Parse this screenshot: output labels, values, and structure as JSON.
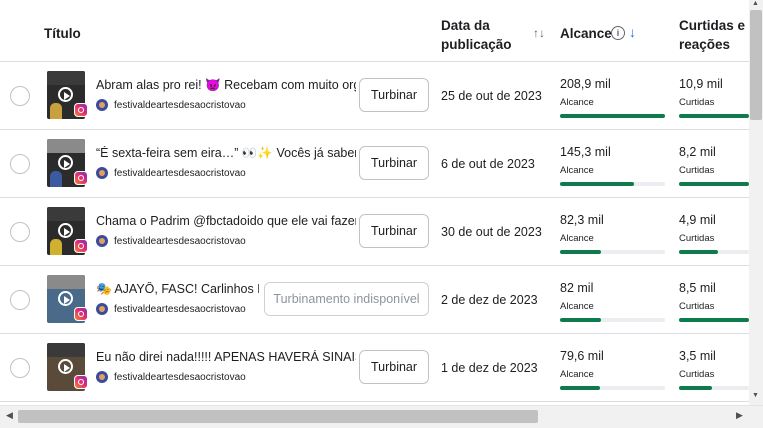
{
  "header": {
    "title": "Título",
    "date": "Data da publicação",
    "sort_icon": "↑↓",
    "reach": "Alcance",
    "info_icon": "i",
    "sort_desc_icon": "↓",
    "likes": "Curtidas e reações"
  },
  "rows": [
    {
      "caption": "Abram alas pro rei! 👿 Recebam com muito orgulho…",
      "account": "festivaldeartesdesaocristovao",
      "boost": "Turbinar",
      "date": "25 de out de 2023",
      "reach": "208,9 mil",
      "reach_label": "Alcance",
      "reach_fraction": 1.0,
      "likes": "10,9 mil",
      "likes_label": "Curtidas",
      "likes_fraction": 1.0
    },
    {
      "caption": "“É sexta-feira sem eira…” 👀✨ Vocês já sabem de …",
      "account": "festivaldeartesdesaocristovao",
      "boost": "Turbinar",
      "date": "6 de out de 2023",
      "reach": "145,3 mil",
      "reach_label": "Alcance",
      "reach_fraction": 0.7,
      "likes": "8,2 mil",
      "likes_label": "Curtidas",
      "likes_fraction": 1.0
    },
    {
      "caption": "Chama o Padrim @fbctadoido que ele vai fazer o F…",
      "account": "festivaldeartesdesaocristovao",
      "boost": "Turbinar",
      "date": "30 de out de 2023",
      "reach": "82,3 mil",
      "reach_label": "Alcance",
      "reach_fraction": 0.39,
      "likes": "4,9 mil",
      "likes_label": "Curtidas",
      "likes_fraction": 0.55
    },
    {
      "caption": "🎭 AJAYÔ, FASC! Carlinhos Bro…",
      "account": "festivaldeartesdesaocristovao",
      "boost": "Turbinamento indisponível",
      "boost_disabled": true,
      "date": "2 de dez de 2023",
      "reach": "82 mil",
      "reach_label": "Alcance",
      "reach_fraction": 0.39,
      "likes": "8,5 mil",
      "likes_label": "Curtidas",
      "likes_fraction": 1.0
    },
    {
      "caption": "Eu não direi nada!!!!! APENAS HAVERÁ SINAIS!!!!!! …",
      "account": "festivaldeartesdesaocristovao",
      "boost": "Turbinar",
      "date": "1 de dez de 2023",
      "reach": "79,6 mil",
      "reach_label": "Alcance",
      "reach_fraction": 0.38,
      "likes": "3,5 mil",
      "likes_label": "Curtidas",
      "likes_fraction": 0.47
    }
  ],
  "scrollbar": {
    "up": "▲",
    "down": "▼",
    "left": "◀",
    "right": "▶"
  },
  "colors": {
    "bar_fill": "#0f7b4c",
    "bar_track": "#ebedf0",
    "sort_accent": "#1877f2"
  }
}
